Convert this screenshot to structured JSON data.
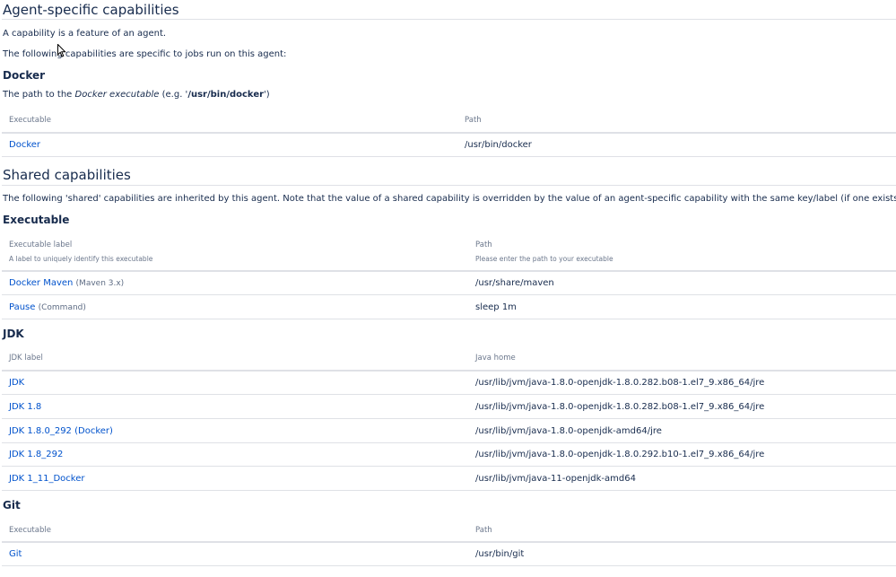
{
  "agent_section": {
    "title": "Agent-specific capabilities",
    "intro": "A capability is a feature of an agent.",
    "specific": "The following capabilities are specific to jobs run on this agent:",
    "docker": {
      "title": "Docker",
      "desc_prefix": "The path to the ",
      "desc_em": "Docker executable",
      "desc_mid": " (e.g. '",
      "desc_code": "/usr/bin/docker",
      "desc_suffix": "')",
      "col_exec": "Executable",
      "col_path": "Path",
      "rows": [
        {
          "label": "Docker",
          "path": "/usr/bin/docker"
        }
      ]
    }
  },
  "shared_section": {
    "title": "Shared capabilities",
    "intro": "The following 'shared' capabilities are inherited by this agent. Note that the value of a shared capability is overridden by the value of an agent-specific capability with the same key/label (if one exists).",
    "executable": {
      "title": "Executable",
      "col_label": "Executable label",
      "col_label_hint": "A label to uniquely identify this executable",
      "col_path": "Path",
      "col_path_hint": "Please enter the path to your executable",
      "rows": [
        {
          "label": "Docker Maven",
          "type": "(Maven 3.x)",
          "path": "/usr/share/maven"
        },
        {
          "label": "Pause",
          "type": "(Command)",
          "path": "sleep 1m"
        }
      ]
    },
    "jdk": {
      "title": "JDK",
      "col_label": "JDK label",
      "col_path": "Java home",
      "rows": [
        {
          "label": "JDK",
          "path": "/usr/lib/jvm/java-1.8.0-openjdk-1.8.0.282.b08-1.el7_9.x86_64/jre"
        },
        {
          "label": "JDK 1.8",
          "path": "/usr/lib/jvm/java-1.8.0-openjdk-1.8.0.282.b08-1.el7_9.x86_64/jre"
        },
        {
          "label": "JDK 1.8.0_292 (Docker)",
          "path": "/usr/lib/jvm/java-1.8.0-openjdk-amd64/jre"
        },
        {
          "label": "JDK 1.8_292",
          "path": "/usr/lib/jvm/java-1.8.0-openjdk-1.8.0.292.b10-1.el7_9.x86_64/jre"
        },
        {
          "label": "JDK 1_11_Docker",
          "path": "/usr/lib/jvm/java-11-openjdk-amd64"
        }
      ]
    },
    "git": {
      "title": "Git",
      "col_exec": "Executable",
      "col_path": "Path",
      "rows": [
        {
          "label": "Git",
          "path": "/usr/bin/git"
        }
      ]
    }
  },
  "icons": {
    "mouse_cursor": "mouse-pointer-icon"
  },
  "colors": {
    "link": "#0052cc",
    "text": "#172b4d",
    "muted": "#6b778c",
    "border": "#dfe1e6"
  }
}
